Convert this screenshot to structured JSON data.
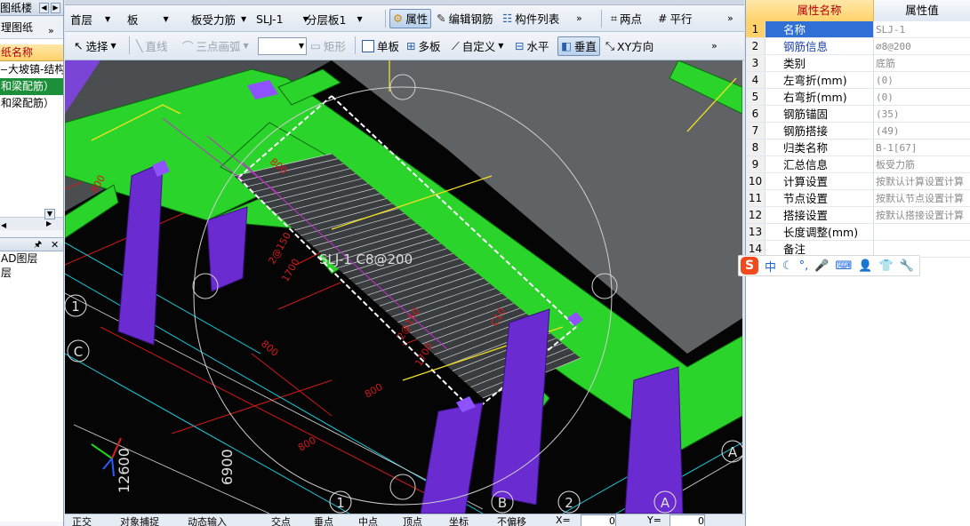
{
  "left_panel": {
    "tab_title": "图纸楼",
    "section_title": "理图纸",
    "header": "纸名称",
    "rows": [
      "大坡镇-结构",
      "和梁配筋）",
      "和梁配筋）"
    ],
    "lower_title": "图层",
    "lower_rows": [
      "AD图层",
      "层"
    ]
  },
  "toolbar1": {
    "floor": "首层",
    "component_type": "板",
    "subtype": "板受力筋",
    "name": "SLJ-1",
    "layer": "分层板1",
    "property_btn": "属性",
    "edit_rebar_btn": "编辑钢筋",
    "component_list_btn": "构件列表",
    "two_points_btn": "两点",
    "parallel_btn": "平行"
  },
  "toolbar2": {
    "select_btn": "选择",
    "line_btn": "直线",
    "arc_btn": "三点画弧",
    "combo_value": "",
    "rect_btn": "矩形",
    "single_slab_btn": "单板",
    "multi_slab_btn": "多板",
    "custom_btn": "自定义",
    "horizontal_btn": "水平",
    "vertical_btn": "垂直",
    "xy_btn": "XY方向"
  },
  "viewport": {
    "rebar_label": "SLJ-1 C8@200",
    "dim_labels": [
      "800",
      "800",
      "800",
      "800",
      "1700",
      "1700",
      "2@150",
      "2@150",
      "800",
      "C10"
    ],
    "grid_labels": [
      "1",
      "C",
      "1",
      "2",
      "B",
      "A",
      "A"
    ],
    "axis_dims": [
      "12600",
      "6900"
    ]
  },
  "bottombar": {
    "items": [
      "正交",
      "对象捕捉",
      "动态输入",
      "交点",
      "垂点",
      "中点",
      "顶点",
      "坐标",
      "不偏移"
    ],
    "x_label": "X=",
    "x_value": "0",
    "y_label": "Y=",
    "y_value": "0"
  },
  "property_grid": {
    "col_name": "属性名称",
    "col_value": "属性值",
    "rows": [
      {
        "num": "1",
        "name": "名称",
        "value": "SLJ-1"
      },
      {
        "num": "2",
        "name": "钢筋信息",
        "value": "⌀8@200"
      },
      {
        "num": "3",
        "name": "类别",
        "value": "底筋"
      },
      {
        "num": "4",
        "name": "左弯折(mm)",
        "value": "(0)"
      },
      {
        "num": "5",
        "name": "右弯折(mm)",
        "value": "(0)"
      },
      {
        "num": "6",
        "name": "钢筋锚固",
        "value": "(35)"
      },
      {
        "num": "7",
        "name": "钢筋搭接",
        "value": "(49)"
      },
      {
        "num": "8",
        "name": "归类名称",
        "value": "B-1[67]"
      },
      {
        "num": "9",
        "name": "汇总信息",
        "value": "板受力筋"
      },
      {
        "num": "10",
        "name": "计算设置",
        "value": "按默认计算设置计算"
      },
      {
        "num": "11",
        "name": "节点设置",
        "value": "按默认节点设置计算"
      },
      {
        "num": "12",
        "name": "搭接设置",
        "value": "按默认搭接设置计算"
      },
      {
        "num": "13",
        "name": "长度调整(mm)",
        "value": ""
      },
      {
        "num": "14",
        "name": "备注",
        "value": ""
      }
    ]
  },
  "ime": {
    "logo": "S",
    "mode": "中"
  }
}
